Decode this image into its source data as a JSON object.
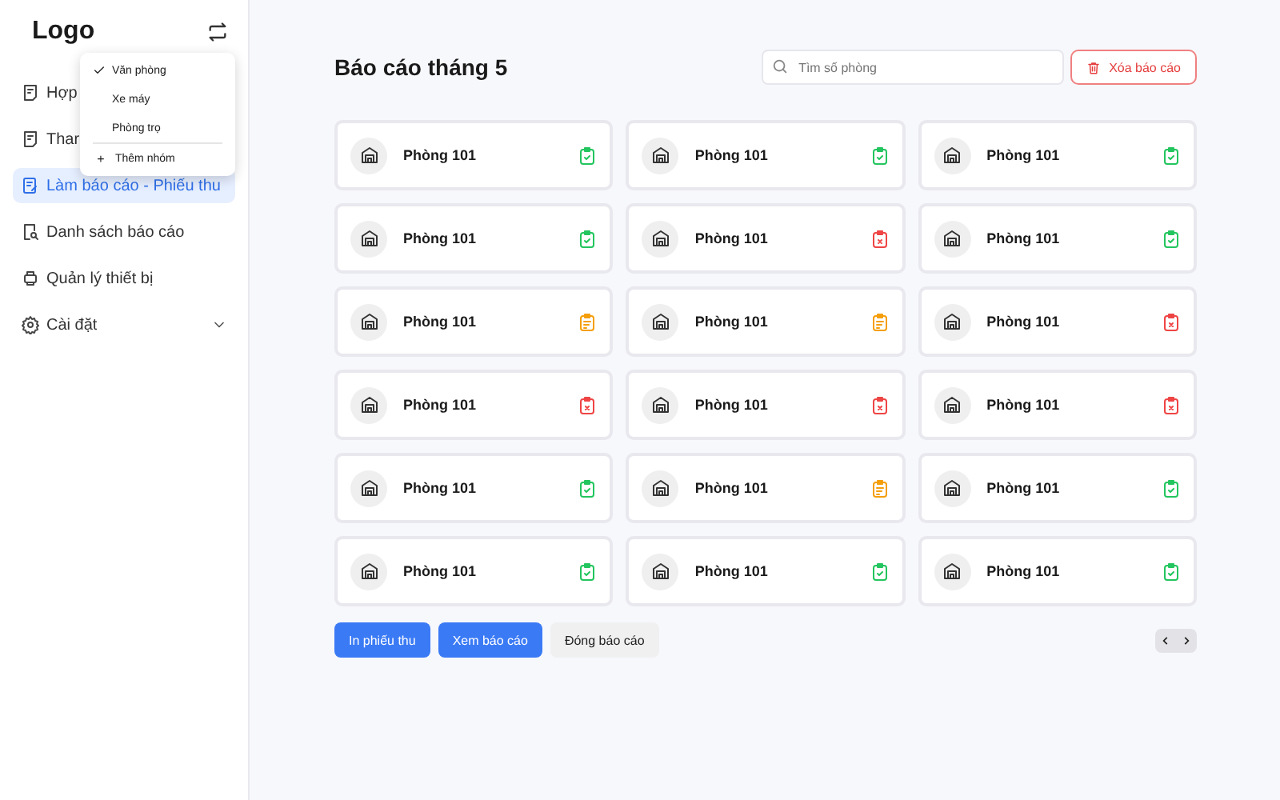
{
  "logo": "Logo",
  "sidebar": {
    "items": [
      {
        "label": "Hợp",
        "selected": false
      },
      {
        "label": "Thar",
        "selected": false
      },
      {
        "label": "Làm báo cáo - Phiếu thu",
        "selected": true
      },
      {
        "label": "Danh sách báo cáo",
        "selected": false
      },
      {
        "label": "Quản lý thiết bị",
        "selected": false
      },
      {
        "label": "Cài đặt",
        "selected": false,
        "expandable": true
      }
    ]
  },
  "group_menu": {
    "items": [
      {
        "label": "Văn phòng",
        "checked": true
      },
      {
        "label": "Xe máy",
        "checked": false
      },
      {
        "label": "Phòng trọ",
        "checked": false
      }
    ],
    "add": {
      "icon": "+",
      "label": "Thêm nhóm"
    }
  },
  "header": {
    "title": "Báo cáo tháng 5",
    "search": {
      "placeholder": "Tìm số phòng"
    },
    "delete_button": "Xóa báo cáo"
  },
  "rooms": [
    {
      "name": "Phòng 101",
      "kind": "done"
    },
    {
      "name": "Phòng 101",
      "kind": "done"
    },
    {
      "name": "Phòng 101",
      "kind": "done"
    },
    {
      "name": "Phòng 101",
      "kind": "done"
    },
    {
      "name": "Phòng 101",
      "kind": "error"
    },
    {
      "name": "Phòng 101",
      "kind": "done"
    },
    {
      "name": "Phòng 101",
      "kind": "pending"
    },
    {
      "name": "Phòng 101",
      "kind": "pending"
    },
    {
      "name": "Phòng 101",
      "kind": "error"
    },
    {
      "name": "Phòng 101",
      "kind": "error"
    },
    {
      "name": "Phòng 101",
      "kind": "error"
    },
    {
      "name": "Phòng 101",
      "kind": "error"
    },
    {
      "name": "Phòng 101",
      "kind": "done"
    },
    {
      "name": "Phòng 101",
      "kind": "pending"
    },
    {
      "name": "Phòng 101",
      "kind": "done"
    },
    {
      "name": "Phòng 101",
      "kind": "done"
    },
    {
      "name": "Phòng 101",
      "kind": "done"
    },
    {
      "name": "Phòng 101",
      "kind": "done"
    }
  ],
  "actions": [
    {
      "label": "In phiếu thu",
      "kind": "primary"
    },
    {
      "label": "Xem báo cáo",
      "kind": "primary"
    },
    {
      "label": "Đóng báo cáo",
      "kind": "secondary"
    }
  ]
}
